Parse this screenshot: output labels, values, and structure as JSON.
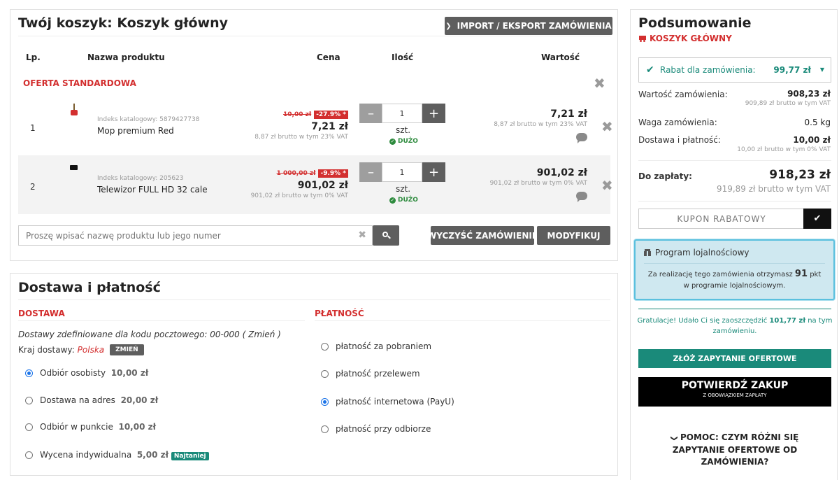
{
  "cart": {
    "title": "Twój koszyk: Koszyk główny",
    "import_export_label": "IMPORT / EKSPORT ZAMÓWIENIA",
    "columns": {
      "lp": "Lp.",
      "name": "Nazwa produktu",
      "price": "Cena",
      "qty": "Ilość",
      "value": "Wartość"
    },
    "offer_label": "OFERTA STANDARDOWA",
    "items": [
      {
        "lp": "1",
        "index": "Indeks katalogowy: 5879427738",
        "name": "Mop premium Red",
        "old_price": "10,00 zł",
        "discount": "-27.9% *",
        "price": "7,21 zł",
        "price_gross": "8,87 zł brutto w tym 23% VAT",
        "qty": "1",
        "unit": "szt.",
        "stock": "DUŻO",
        "value": "7,21 zł",
        "value_gross": "8,87 zł brutto w tym 23% VAT"
      },
      {
        "lp": "2",
        "index": "Indeks katalogowy: 205623",
        "name": "Telewizor FULL HD 32 cale",
        "old_price": "1 000,00 zł",
        "discount": "-9.9% *",
        "price": "901,02 zł",
        "price_gross": "901,02 zł brutto w tym 0% VAT",
        "qty": "1",
        "unit": "szt.",
        "stock": "DUŻO",
        "value": "901,02 zł",
        "value_gross": "901,02 zł brutto w tym 0% VAT"
      }
    ],
    "search_placeholder": "Proszę wpisać nazwę produktu lub jego numer",
    "clear_label": "WYCZYŚĆ ZAMÓWIENIE",
    "modify_label": "MODYFIKUJ"
  },
  "delivery": {
    "title": "Dostawa i płatność",
    "delivery_label": "DOSTAWA",
    "payment_label": "PŁATNOŚĆ",
    "postal_note": "Dostawy zdefiniowane dla kodu pocztowego: 00-000 ( Zmień )",
    "country_label": "Kraj dostawy:",
    "country_value": "Polska",
    "change_label": "ZMIEŃ",
    "options": [
      {
        "name": "Odbiór osobisty",
        "price": "10,00 zł",
        "checked": true
      },
      {
        "name": "Dostawa na adres",
        "price": "20,00 zł",
        "checked": false
      },
      {
        "name": "Odbiór w punkcie",
        "price": "10,00 zł",
        "checked": false
      },
      {
        "name": "Wycena indywidualna",
        "price": "5,00 zł",
        "checked": false,
        "tag": "Najtaniej"
      }
    ],
    "payments": [
      {
        "name": "płatność za pobraniem",
        "checked": false
      },
      {
        "name": "płatność przelewem",
        "checked": false
      },
      {
        "name": "płatność internetowa (PayU)",
        "checked": true
      },
      {
        "name": "płatność przy odbiorze",
        "checked": false
      }
    ]
  },
  "summary": {
    "title": "Podsumowanie",
    "cart_name": "KOSZYK GŁÓWNY",
    "discount_label": "Rabat dla zamówienia:",
    "discount_value": "99,77 zł",
    "order_value_label": "Wartość zamówienia:",
    "order_value": "908,23 zł",
    "order_value_gross": "909,89 zł brutto w tym VAT",
    "weight_label": "Waga zamówienia:",
    "weight_value": "0.5 kg",
    "shipping_label": "Dostawa i płatność:",
    "shipping_value": "10,00 zł",
    "shipping_gross": "10,00 zł brutto w tym 0% VAT",
    "total_label": "Do zapłaty:",
    "total_value": "918,23 zł",
    "total_gross": "919,89 zł brutto w tym VAT",
    "coupon_placeholder": "KUPON RABATOWY",
    "loyalty_title": "Program lojalnościowy",
    "loyalty_text_1": "Za realizację tego zamówienia otrzymasz",
    "loyalty_points": "91",
    "loyalty_text_2": "pkt",
    "loyalty_text_3": "w programie lojalnościowym.",
    "congrats_1": "Gratulacje! Udało Ci się zaoszczędzić",
    "congrats_amount": "101,77 zł",
    "congrats_2": "na tym",
    "congrats_3": "zamówieniu.",
    "quote_label": "ZŁÓŻ ZAPYTANIE OFERTOWE",
    "confirm_label": "POTWIERDŹ ZAKUP",
    "confirm_sub": "Z OBOWIĄZKIEM ZAPŁATY",
    "help_line1": "POMOC: CZYM RÓŻNI SIĘ",
    "help_line2": "ZAPYTANIE OFERTOWE OD",
    "help_line3": "ZAMÓWIENIA?"
  },
  "colors": {
    "accent_red": "#d32f2f",
    "teal": "#1a8a7a",
    "dark_btn": "#5e5e5e",
    "loyalty_bg": "#cfe8f0"
  }
}
